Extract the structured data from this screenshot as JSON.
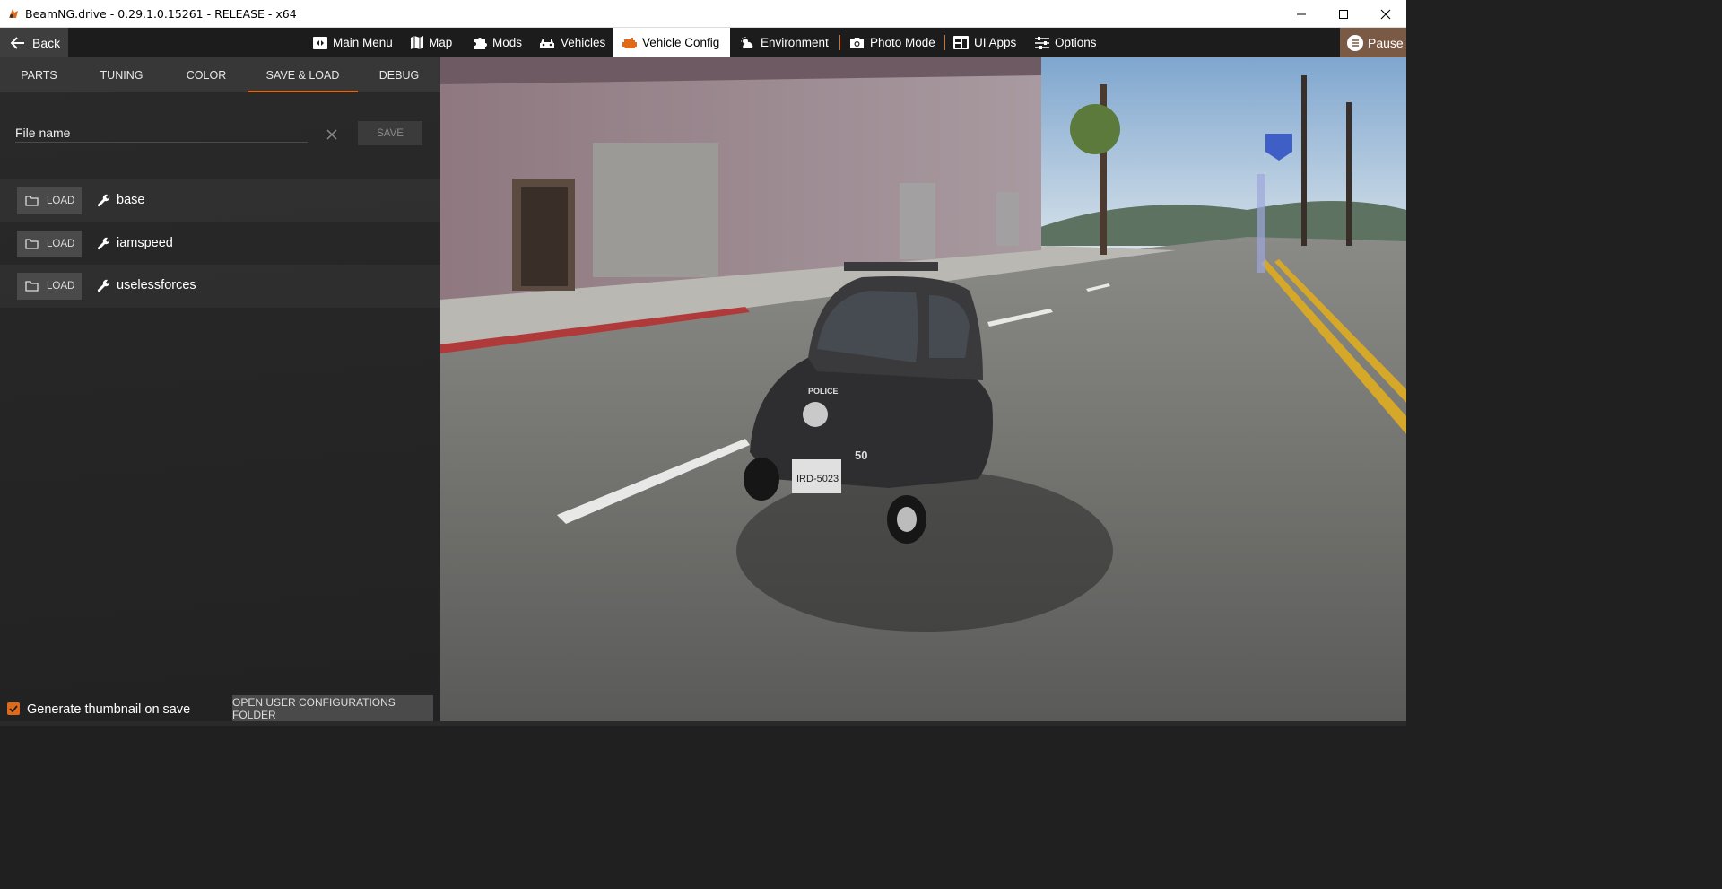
{
  "window": {
    "title": "BeamNG.drive - 0.29.1.0.15261 - RELEASE - x64",
    "controls": [
      "minimize-icon",
      "maximize-icon",
      "close-icon"
    ]
  },
  "topbar": {
    "back_label": "Back",
    "nav": [
      {
        "label": "Main Menu",
        "icon": "main-menu-icon"
      },
      {
        "label": "Map",
        "icon": "map-icon"
      },
      {
        "label": "Mods",
        "icon": "puzzle-icon"
      },
      {
        "label": "Vehicles",
        "icon": "car-icon"
      },
      {
        "label": "Vehicle Config",
        "icon": "engine-icon",
        "active": true
      },
      {
        "label": "Environment",
        "icon": "weather-icon"
      },
      {
        "label": "Photo Mode",
        "icon": "camera-icon"
      },
      {
        "label": "UI Apps",
        "icon": "dashboard-icon"
      },
      {
        "label": "Options",
        "icon": "sliders-icon"
      }
    ],
    "pause_label": "Pause"
  },
  "panel": {
    "tabs": [
      {
        "label": "PARTS"
      },
      {
        "label": "TUNING"
      },
      {
        "label": "COLOR"
      },
      {
        "label": "SAVE & LOAD",
        "active": true
      },
      {
        "label": "DEBUG"
      }
    ],
    "file_name_placeholder": "File name",
    "save_label": "SAVE",
    "load_label": "LOAD",
    "configs": [
      {
        "name": "base"
      },
      {
        "name": "iamspeed"
      },
      {
        "name": "uselessforces"
      }
    ],
    "thumbnail_label": "Generate thumbnail on save",
    "thumbnail_checked": true,
    "open_folder_label": "OPEN USER CONFIGURATIONS FOLDER"
  },
  "viewport": {
    "license_plate": "IRD-5023",
    "car_number": "50",
    "car_text": "POLICE"
  },
  "colors": {
    "accent": "#e06a1b",
    "panel_bg": "#262626",
    "tab_bg": "#373737",
    "button_bg": "#4a4a4a"
  }
}
